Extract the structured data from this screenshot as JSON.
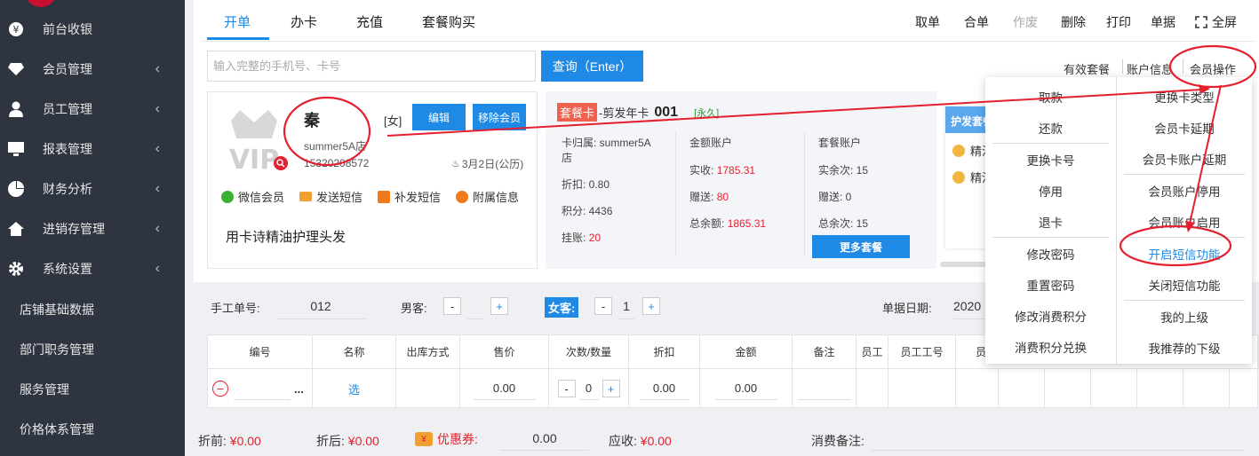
{
  "sidebar": {
    "items": [
      {
        "label": "前台收银",
        "icon": "yen-icon"
      },
      {
        "label": "会员管理",
        "icon": "diamond-icon"
      },
      {
        "label": "员工管理",
        "icon": "user-icon"
      },
      {
        "label": "报表管理",
        "icon": "monitor-icon"
      },
      {
        "label": "财务分析",
        "icon": "pie-icon"
      },
      {
        "label": "进销存管理",
        "icon": "home-icon"
      },
      {
        "label": "系统设置",
        "icon": "gear-icon"
      }
    ],
    "subitems": [
      "店铺基础数据",
      "部门职务管理",
      "服务管理",
      "价格体系管理"
    ]
  },
  "tabs": [
    "开单",
    "办卡",
    "充值",
    "套餐购买"
  ],
  "toolbar": {
    "qudan": "取单",
    "hedan": "合单",
    "zuofei": "作废",
    "shanchu": "删除",
    "dayin": "打印",
    "danju": "单据",
    "quanping": "全屏"
  },
  "search": {
    "placeholder": "输入完整的手机号、卡号",
    "button": "查询（Enter）"
  },
  "right_links": {
    "package": "有效套餐",
    "account": "账户信息",
    "member_ops": "会员操作"
  },
  "member": {
    "name": "秦",
    "gender": "[女]",
    "edit": "编辑",
    "remove": "移除会员",
    "store": "summer5A店",
    "phone": "15320208572",
    "birthday": "3月2日(公历)",
    "logo_text": "VIP",
    "actions": [
      "微信会员",
      "发送短信",
      "补发短信",
      "附属信息"
    ],
    "note": "用卡诗精油护理头发"
  },
  "card": {
    "tag": "套餐卡",
    "name": "-剪发年卡",
    "no": "001",
    "period": "[永久]",
    "col1": {
      "belong_label": "卡归属: summer5A",
      "belong_label2": "店",
      "discount": "折扣: 0.80",
      "points": "积分: 4436",
      "credit_label": "挂账:",
      "credit": "20"
    },
    "col2": {
      "title": "金额账户",
      "paid_label": "实收:",
      "paid": "1785.31",
      "gift_label": "赠送:",
      "gift": "80",
      "total_label": "总余额:",
      "total": "1865.31"
    },
    "col3": {
      "title": "套餐账户",
      "remain_label": "实余次: 15",
      "gift_label": "赠送: 0",
      "total_label": "总余次: 15"
    },
    "more_button": "更多套餐"
  },
  "card3": {
    "title": "护发套餐",
    "items": [
      "精油",
      "精油"
    ]
  },
  "form": {
    "manual_no_label": "手工单号:",
    "manual_no": "012",
    "male_label": "男客:",
    "male": "",
    "female_label": "女客:",
    "female": "1",
    "date_label": "单据日期:",
    "date": "2020"
  },
  "table": {
    "headers": [
      "编号",
      "名称",
      "出库方式",
      "售价",
      "次数/数量",
      "折扣",
      "金额",
      "备注",
      "员工",
      "员工工号",
      "员"
    ],
    "row": {
      "name": "选",
      "price": "0.00",
      "qty": "0",
      "discount": "0.00",
      "amount": "0.00",
      "more": "..."
    }
  },
  "footer": {
    "before_label": "折前:",
    "before": "¥0.00",
    "after_label": "折后:",
    "after": "¥0.00",
    "coupon_label": "优惠券:",
    "coupon": "0.00",
    "due_label": "应收:",
    "due": "¥0.00",
    "remark_label": "消费备注:"
  },
  "menu": {
    "left": [
      "取款",
      "还款",
      "更换卡号",
      "停用",
      "退卡",
      "修改密码",
      "重置密码",
      "修改消费积分",
      "消费积分兑换"
    ],
    "right": [
      "更换卡类型",
      "会员卡延期",
      "会员卡账户延期",
      "会员账户停用",
      "会员账户启用",
      "开启短信功能",
      "关闭短信功能",
      "我的上级",
      "我推荐的下级"
    ]
  },
  "colors": {
    "accent": "#1e8ae6",
    "sidebar": "#2f3540",
    "red": "#e5202e",
    "annotation": "#e5202e"
  }
}
